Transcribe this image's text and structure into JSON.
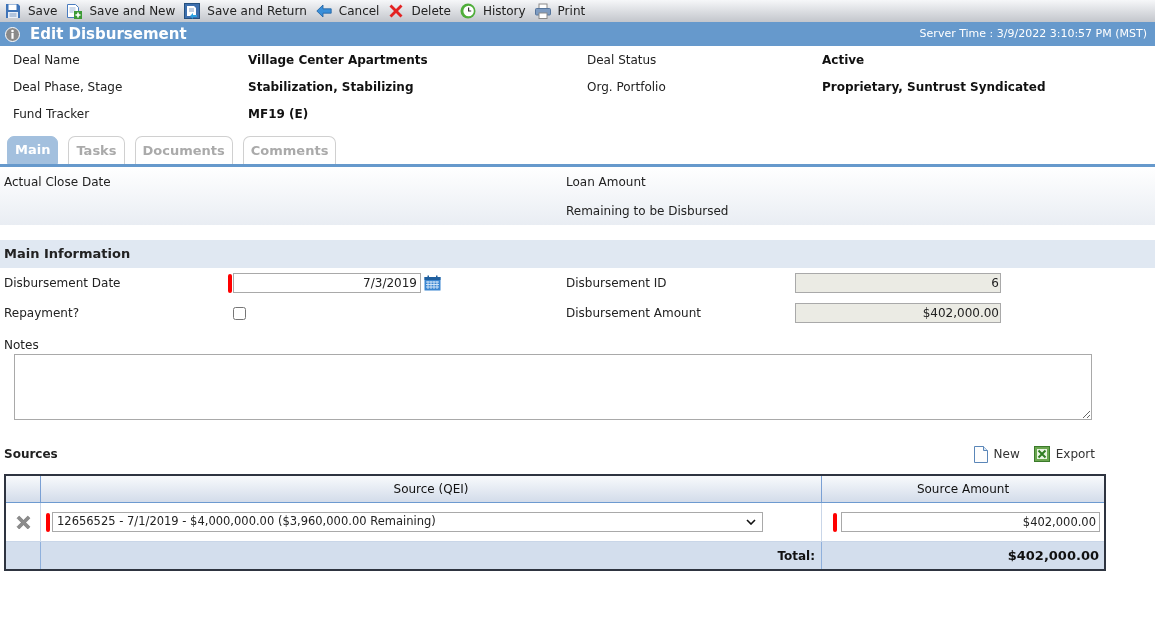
{
  "toolbar": [
    {
      "kind": "save",
      "label": "Save"
    },
    {
      "kind": "save_new",
      "label": "Save and New"
    },
    {
      "kind": "save_return",
      "label": "Save and Return"
    },
    {
      "kind": "cancel",
      "label": "Cancel"
    },
    {
      "kind": "delete",
      "label": "Delete"
    },
    {
      "kind": "history",
      "label": "History"
    },
    {
      "kind": "print",
      "label": "Print"
    }
  ],
  "header": {
    "title": "Edit Disbursement",
    "server_time": "Server Time : 3/9/2022 3:10:57 PM (MST)"
  },
  "deal_info": [
    {
      "label": "Deal Name",
      "value": "Village Center Apartments"
    },
    {
      "label": "Deal Status",
      "value": "Active"
    },
    {
      "label": "Deal Phase, Stage",
      "value": "Stabilization, Stabilizing"
    },
    {
      "label": "Org. Portfolio",
      "value": "Proprietary, Suntrust Syndicated"
    },
    {
      "label": "Fund Tracker",
      "value": "MF19 (E)"
    }
  ],
  "tabs": [
    {
      "label": "Main",
      "selected": true
    },
    {
      "label": "Tasks",
      "selected": false
    },
    {
      "label": "Documents",
      "selected": false
    },
    {
      "label": "Comments",
      "selected": false
    }
  ],
  "summary": {
    "left": [
      "Actual Close Date"
    ],
    "right": [
      "Loan Amount",
      "Remaining to be Disbursed"
    ]
  },
  "main_information": {
    "title": "Main Information",
    "disbursement_date": {
      "label": "Disbursement Date",
      "value": "7/3/2019",
      "required": true
    },
    "disbursement_id": {
      "label": "Disbursement ID",
      "value": "6",
      "disabled": true
    },
    "repayment": {
      "label": "Repayment?",
      "checked": false
    },
    "disbursement_amount": {
      "label": "Disbursement Amount",
      "value": "$402,000.00",
      "disabled": true
    },
    "notes": {
      "label": "Notes"
    }
  },
  "sources": {
    "title": "Sources",
    "actions": [
      {
        "kind": "new",
        "label": "New"
      },
      {
        "kind": "export",
        "label": "Export"
      }
    ],
    "columns": [
      "Source (QEI)",
      "Source Amount"
    ],
    "rows": [
      {
        "source": "12656525 - 7/1/2019 - $4,000,000.00 ($3,960,000.00 Remaining)",
        "amount": "$402,000.00",
        "required": true
      }
    ],
    "total_label": "Total:",
    "total": "$402,000.00"
  }
}
